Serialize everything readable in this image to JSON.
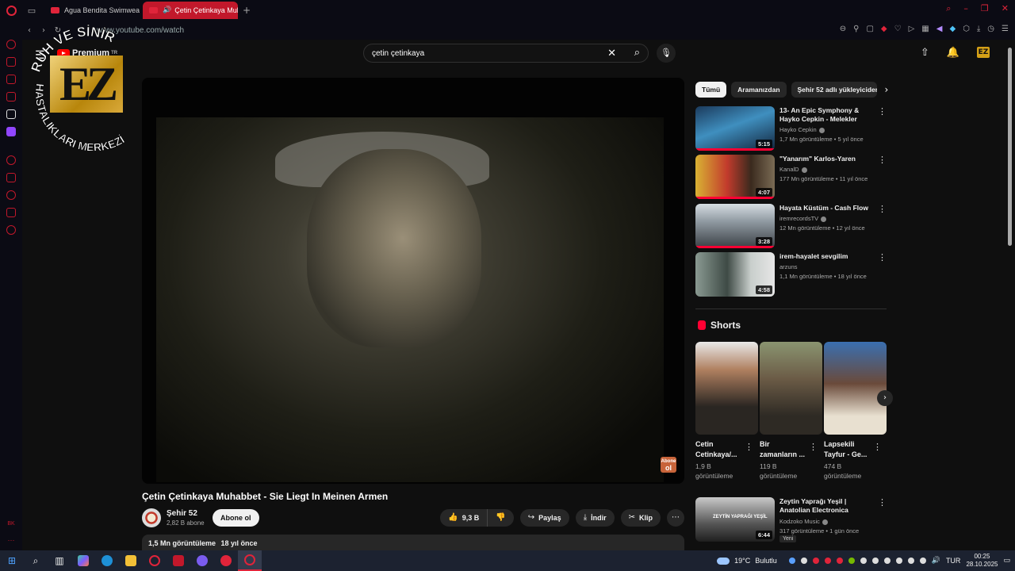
{
  "browser": {
    "tabs": [
      {
        "label": "Agua Bendita Swimwear F",
        "active": false
      },
      {
        "label": "Çetin Çetinkaya Muha",
        "active": true
      }
    ],
    "url": "www.youtube.com/watch"
  },
  "youtube": {
    "logo_label": "Premium",
    "logo_region": "TR",
    "search_query": "çetin çetinkaya"
  },
  "watermark": {
    "top_text": "RUH VE SİNİR",
    "side_text": "HASTALIKLARI MERKEZİ",
    "mark": "EZ"
  },
  "video": {
    "title": "Çetin Çetinkaya Muhabbet - Sie Liegt In Meinen Armen",
    "badge_line1": "Abone",
    "badge_line2": "ol",
    "channel": "Şehir 52",
    "subscribers": "2,82 B abone",
    "subscribe_label": "Abone ol",
    "likes": "9,3 B",
    "share_label": "Paylaş",
    "download_label": "İndir",
    "clip_label": "Klip",
    "views": "1,5 Mn görüntüleme",
    "age": "18 yıl önce"
  },
  "chips": [
    "Tümü",
    "Aramanızdan",
    "Şehir 52 adlı yükleyiciden"
  ],
  "recommendations": [
    {
      "title": "13- An Epic Symphony & Hayko Cepkin - Melekler",
      "channel": "Hayko Cepkin",
      "views": "1,7 Mn görüntüleme",
      "age": "5 yıl önce",
      "duration": "5:15",
      "watched": 1.0,
      "verified": true
    },
    {
      "title": "\"Yanarım\" Karlos-Yaren",
      "channel": "KanalD",
      "views": "177 Mn görüntüleme",
      "age": "11 yıl önce",
      "duration": "4:07",
      "watched": 1.0,
      "verified": true
    },
    {
      "title": "Hayata Küstüm - Cash Flow",
      "channel": "iremrecordsTV",
      "views": "12 Mn görüntüleme",
      "age": "12 yıl önce",
      "duration": "3:28",
      "watched": 1.0,
      "verified": true
    },
    {
      "title": "irem-hayalet sevgilim",
      "channel": "arzuns",
      "views": "1,1 Mn görüntüleme",
      "age": "18 yıl önce",
      "duration": "4:58",
      "watched": 0,
      "verified": false
    }
  ],
  "shorts": {
    "header": "Shorts",
    "items": [
      {
        "title": "Cetin Cetinkaya/...",
        "views": "1,9 B görüntüleme"
      },
      {
        "title": "Bir zamanların ...",
        "views": "119 B görüntüleme"
      },
      {
        "title": "Lapsekili Tayfur - Ge...",
        "views": "474 B görüntüleme"
      }
    ]
  },
  "bottom_rec": {
    "title": "Zeytin Yaprağı Yeşil | Anatolian Electronica",
    "channel": "Kodzoko Music",
    "views": "317 görüntüleme",
    "age": "1 gün önce",
    "duration": "6:44",
    "tag": "Yeni",
    "thumb_text": "ZEYTİN YAPRAĞI YEŞİL"
  },
  "taskbar": {
    "temperature": "19°C",
    "weather": "Bulutlu",
    "language": "TUR",
    "time": "00:25",
    "date": "28.10.2025"
  },
  "sidebar_bottom_label": "BK",
  "colors": {
    "accent": "#e0243a",
    "yt_red": "#ff0033",
    "bg": "#0f0f0f"
  }
}
